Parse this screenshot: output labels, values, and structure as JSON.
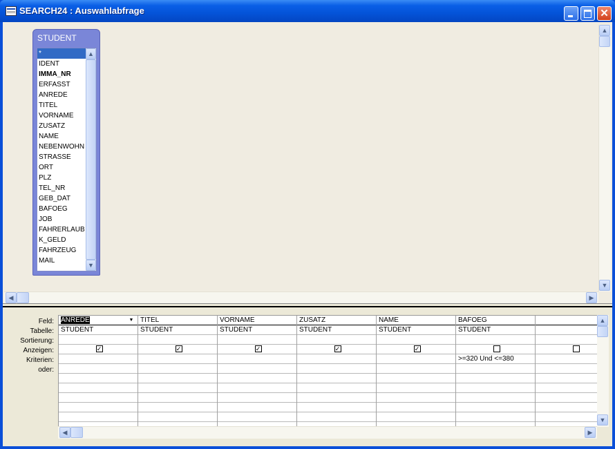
{
  "window": {
    "title": "SEARCH24 : Auswahlabfrage"
  },
  "table_list": {
    "title": "STUDENT",
    "fields": [
      "*",
      "IDENT",
      "IMMA_NR",
      "ERFASST",
      "ANREDE",
      "TITEL",
      "VORNAME",
      "ZUSATZ",
      "NAME",
      "NEBENWOHN",
      "STRASSE",
      "ORT",
      "PLZ",
      "TEL_NR",
      "GEB_DAT",
      "BAFOEG",
      "JOB",
      "FAHRERLAUB",
      "K_GELD",
      "FAHRZEUG",
      "MAIL"
    ],
    "selected_field": "*",
    "key_field": "IMMA_NR"
  },
  "grid": {
    "row_labels": [
      "Feld:",
      "Tabelle:",
      "Sortierung:",
      "Anzeigen:",
      "Kriterien:",
      "oder:"
    ],
    "columns": [
      {
        "field": "ANREDE",
        "table": "STUDENT",
        "sort": "",
        "show": true,
        "criteria": "",
        "or": ""
      },
      {
        "field": "TITEL",
        "table": "STUDENT",
        "sort": "",
        "show": true,
        "criteria": "",
        "or": ""
      },
      {
        "field": "VORNAME",
        "table": "STUDENT",
        "sort": "",
        "show": true,
        "criteria": "",
        "or": ""
      },
      {
        "field": "ZUSATZ",
        "table": "STUDENT",
        "sort": "",
        "show": true,
        "criteria": "",
        "or": ""
      },
      {
        "field": "NAME",
        "table": "STUDENT",
        "sort": "",
        "show": true,
        "criteria": "",
        "or": ""
      },
      {
        "field": "BAFOEG",
        "table": "STUDENT",
        "sort": "",
        "show": false,
        "criteria": ">=320 Und <=380",
        "or": ""
      },
      {
        "field": "",
        "table": "",
        "sort": "",
        "show": false,
        "criteria": "",
        "or": ""
      }
    ],
    "check_mark": "✓"
  }
}
